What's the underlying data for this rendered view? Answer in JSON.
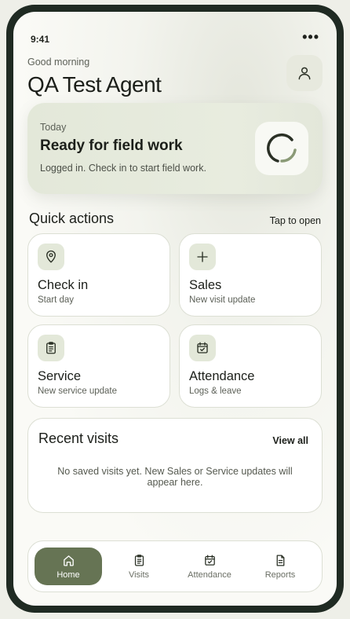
{
  "status_bar": {
    "time": "9:41",
    "more_glyph": "•••"
  },
  "header": {
    "greeting": "Good morning",
    "name": "QA Test Agent",
    "profile_icon": "user-icon"
  },
  "status_card": {
    "label": "Today",
    "title": "Ready for field work",
    "subtitle": "Logged in. Check in to start field work.",
    "indicator_icon": "loading-spinner-icon"
  },
  "quick_actions": {
    "title": "Quick actions",
    "hint": "Tap to open",
    "items": [
      {
        "label": "Check in",
        "sub": "Start day",
        "icon": "map-pin-icon"
      },
      {
        "label": "Sales",
        "sub": "New visit update",
        "icon": "plus-icon"
      },
      {
        "label": "Service",
        "sub": "New service update",
        "icon": "clipboard-list-icon"
      },
      {
        "label": "Attendance",
        "sub": "Logs & leave",
        "icon": "calendar-check-icon"
      }
    ]
  },
  "recent_visits": {
    "title": "Recent visits",
    "view_all": "View all",
    "empty_text": "No saved visits yet. New Sales or Service updates will appear here."
  },
  "nav": {
    "active": "Home",
    "items": [
      {
        "label": "Home",
        "icon": "home-icon"
      },
      {
        "label": "Visits",
        "icon": "clipboard-icon"
      },
      {
        "label": "Attendance",
        "icon": "calendar-check-icon"
      },
      {
        "label": "Reports",
        "icon": "document-icon"
      }
    ]
  },
  "colors": {
    "accent": "#667454",
    "card_tint": "#e3e8d9",
    "phone_frame": "#1f2a22"
  }
}
